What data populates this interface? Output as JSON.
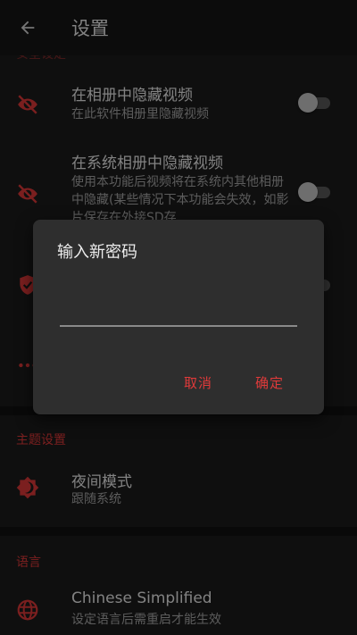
{
  "header": {
    "title": "设置",
    "back_icon": "arrow-back-icon"
  },
  "sections": {
    "security": {
      "header": "安全设定"
    },
    "theme": {
      "header": "主题设置"
    },
    "language": {
      "header": "语言"
    }
  },
  "settings": {
    "hide_in_album": {
      "title": "在相册中隐藏视频",
      "subtitle": "在此软件相册里隐藏视频",
      "icon": "eye-off-icon",
      "enabled": false
    },
    "hide_in_system": {
      "title": "在系统相册中隐藏视频",
      "subtitle": "使用本功能后视频将在系统内其他相册中隐藏(某些情况下本功能会失效，如影片保存在外接SD存",
      "icon": "eye-off-icon",
      "enabled": false
    },
    "password": {
      "icon": "shield-icon",
      "enabled": false
    },
    "more": {
      "icon": "more-icon"
    },
    "night_mode": {
      "title": "夜间模式",
      "subtitle": "跟随系统",
      "icon": "brightness-icon"
    },
    "language": {
      "title": "Chinese Simplified",
      "subtitle": "设定语言后需重启才能生效",
      "icon": "globe-icon"
    }
  },
  "dialog": {
    "title": "输入新密码",
    "input_value": "",
    "cancel_label": "取消",
    "confirm_label": "确定"
  },
  "colors": {
    "accent": "#e03a3a",
    "background": "#1c1c1c",
    "dialog": "#2e2e2e"
  }
}
